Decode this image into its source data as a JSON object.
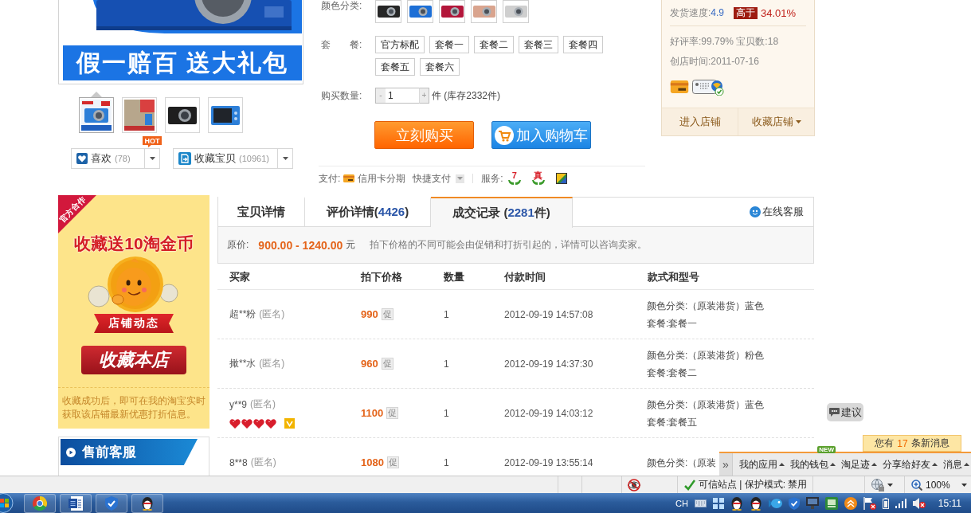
{
  "product_image": {
    "caption": "假一赔百 送大礼包"
  },
  "thumbnails": [
    {
      "kind": "boxed-camera",
      "selected": true
    },
    {
      "kind": "poster",
      "selected": false
    },
    {
      "kind": "black-camera",
      "selected": false
    },
    {
      "kind": "camera-back",
      "selected": false
    }
  ],
  "social_buttons": [
    {
      "kind": "like",
      "label": "喜欢",
      "count": "(78)",
      "badge": "HOT"
    },
    {
      "kind": "collect",
      "label": "收藏宝贝",
      "count": "(10961)"
    }
  ],
  "color_option": {
    "label": "颜色分类:",
    "swatches": [
      {
        "color": "#262626",
        "selected": false
      },
      {
        "color": "#1d6fd6",
        "selected": false
      },
      {
        "color": "#b3163a",
        "selected": false
      },
      {
        "color": "#d9a48e",
        "selected": false
      },
      {
        "color": "#cfcfcf",
        "selected": false
      }
    ]
  },
  "package_option": {
    "label": "套　　餐:",
    "items": [
      {
        "label": "官方标配",
        "selected": false
      },
      {
        "label": "套餐一",
        "selected": false
      },
      {
        "label": "套餐二",
        "selected": false
      },
      {
        "label": "套餐三",
        "selected": false
      },
      {
        "label": "套餐四",
        "selected": false
      },
      {
        "label": "套餐五",
        "selected": false
      },
      {
        "label": "套餐六",
        "selected": false
      }
    ]
  },
  "quantity": {
    "label": "购买数量:",
    "minus": "-",
    "value": "1",
    "plus": "+",
    "stock": "件 (库存2332件)"
  },
  "actions": [
    {
      "kind": "buy",
      "label": "立刻购买"
    },
    {
      "kind": "cart",
      "label": "加入购物车"
    }
  ],
  "payment": {
    "label": "支付:",
    "methods": [
      {
        "kind": "card",
        "label": "信用卡分期"
      },
      {
        "kind": "dropdown",
        "label": "快捷支付"
      }
    ]
  },
  "services": {
    "label": "服务:",
    "items": [
      {
        "kind": "mark",
        "mark": "7"
      },
      {
        "kind": "mark",
        "mark": "真"
      },
      {
        "kind": "square"
      }
    ]
  },
  "shop": {
    "speed_label": "发货速度:",
    "speed": "4.9",
    "compare": "高于",
    "compare_value": "34.01%",
    "rating": "好评率:99.79% 宝贝数:18",
    "founded": "创店时间:2011-07-16",
    "links": [
      {
        "label": "进入店铺",
        "dropdown": false
      },
      {
        "label": "收藏店铺",
        "dropdown": true
      }
    ]
  },
  "promo": {
    "corner": "官方合作",
    "headline": "收藏送10淘金币",
    "ribbon": "店铺动态",
    "button": "收藏本店",
    "note": "收藏成功后，即可在我的淘宝实时获取该店铺最新优惠打折信息。"
  },
  "customer_service": {
    "title": "售前客服"
  },
  "tabs": [
    {
      "prefix": "宝贝详情",
      "selected": false
    },
    {
      "prefix": "评价详情(",
      "count": "4426",
      "suffix": ")",
      "selected": false
    },
    {
      "prefix": "成交记录 (",
      "count": "2281",
      "suffix": "件)",
      "selected": true
    }
  ],
  "online_service": {
    "label": "在线客服"
  },
  "price_note": {
    "label": "原价:",
    "range": "900.00 - 1240.00",
    "unit": "元",
    "note": "拍下价格的不同可能会由促销和打折引起的，详情可以咨询卖家。"
  },
  "table": {
    "columns": [
      "买家",
      "拍下价格",
      "数量",
      "付款时间",
      "款式和型号"
    ],
    "rows": [
      {
        "buyer": "超**粉",
        "anonymous": "(匿名)",
        "price": "990",
        "promo": "促",
        "quantity": "1",
        "paid_at": "2012-09-19 14:57:08",
        "spec": [
          "颜色分类:（原装港货）蓝色",
          "套餐:套餐一"
        ]
      },
      {
        "buyer": "撖**水",
        "anonymous": "(匿名)",
        "price": "960",
        "promo": "促",
        "quantity": "1",
        "paid_at": "2012-09-19 14:37:30",
        "spec": [
          "颜色分类:（原装港货）粉色",
          "套餐:套餐二"
        ]
      },
      {
        "buyer": "y**9",
        "anonymous": "(匿名)",
        "stars": 4,
        "vip": true,
        "price": "1100",
        "promo": "促",
        "quantity": "1",
        "paid_at": "2012-09-19 14:03:12",
        "spec": [
          "颜色分类:（原装港货）蓝色",
          "套餐:套餐五"
        ]
      },
      {
        "buyer": "8**8",
        "anonymous": "(匿名)",
        "price": "1080",
        "promo": "促",
        "quantity": "1",
        "paid_at": "2012-09-19 13:55:14",
        "spec": [
          "颜色分类:（原装"
        ]
      }
    ]
  },
  "feedback_button": {
    "label": "建议"
  },
  "message_tip": {
    "prefix": "您有",
    "count": "17",
    "suffix": "条新消息"
  },
  "toolbar": {
    "expand": "»",
    "items": [
      {
        "label": "我的应用"
      },
      {
        "label": "我的钱包",
        "badge": "NEW"
      },
      {
        "label": "淘足迹"
      },
      {
        "label": "分享给好友"
      },
      {
        "label": "消息"
      }
    ]
  },
  "status_bar": {
    "zone": "可信站点 | 保护模式: 禁用",
    "zoom": "100%"
  },
  "taskbar": {
    "language": "CH",
    "time": "15:11"
  }
}
